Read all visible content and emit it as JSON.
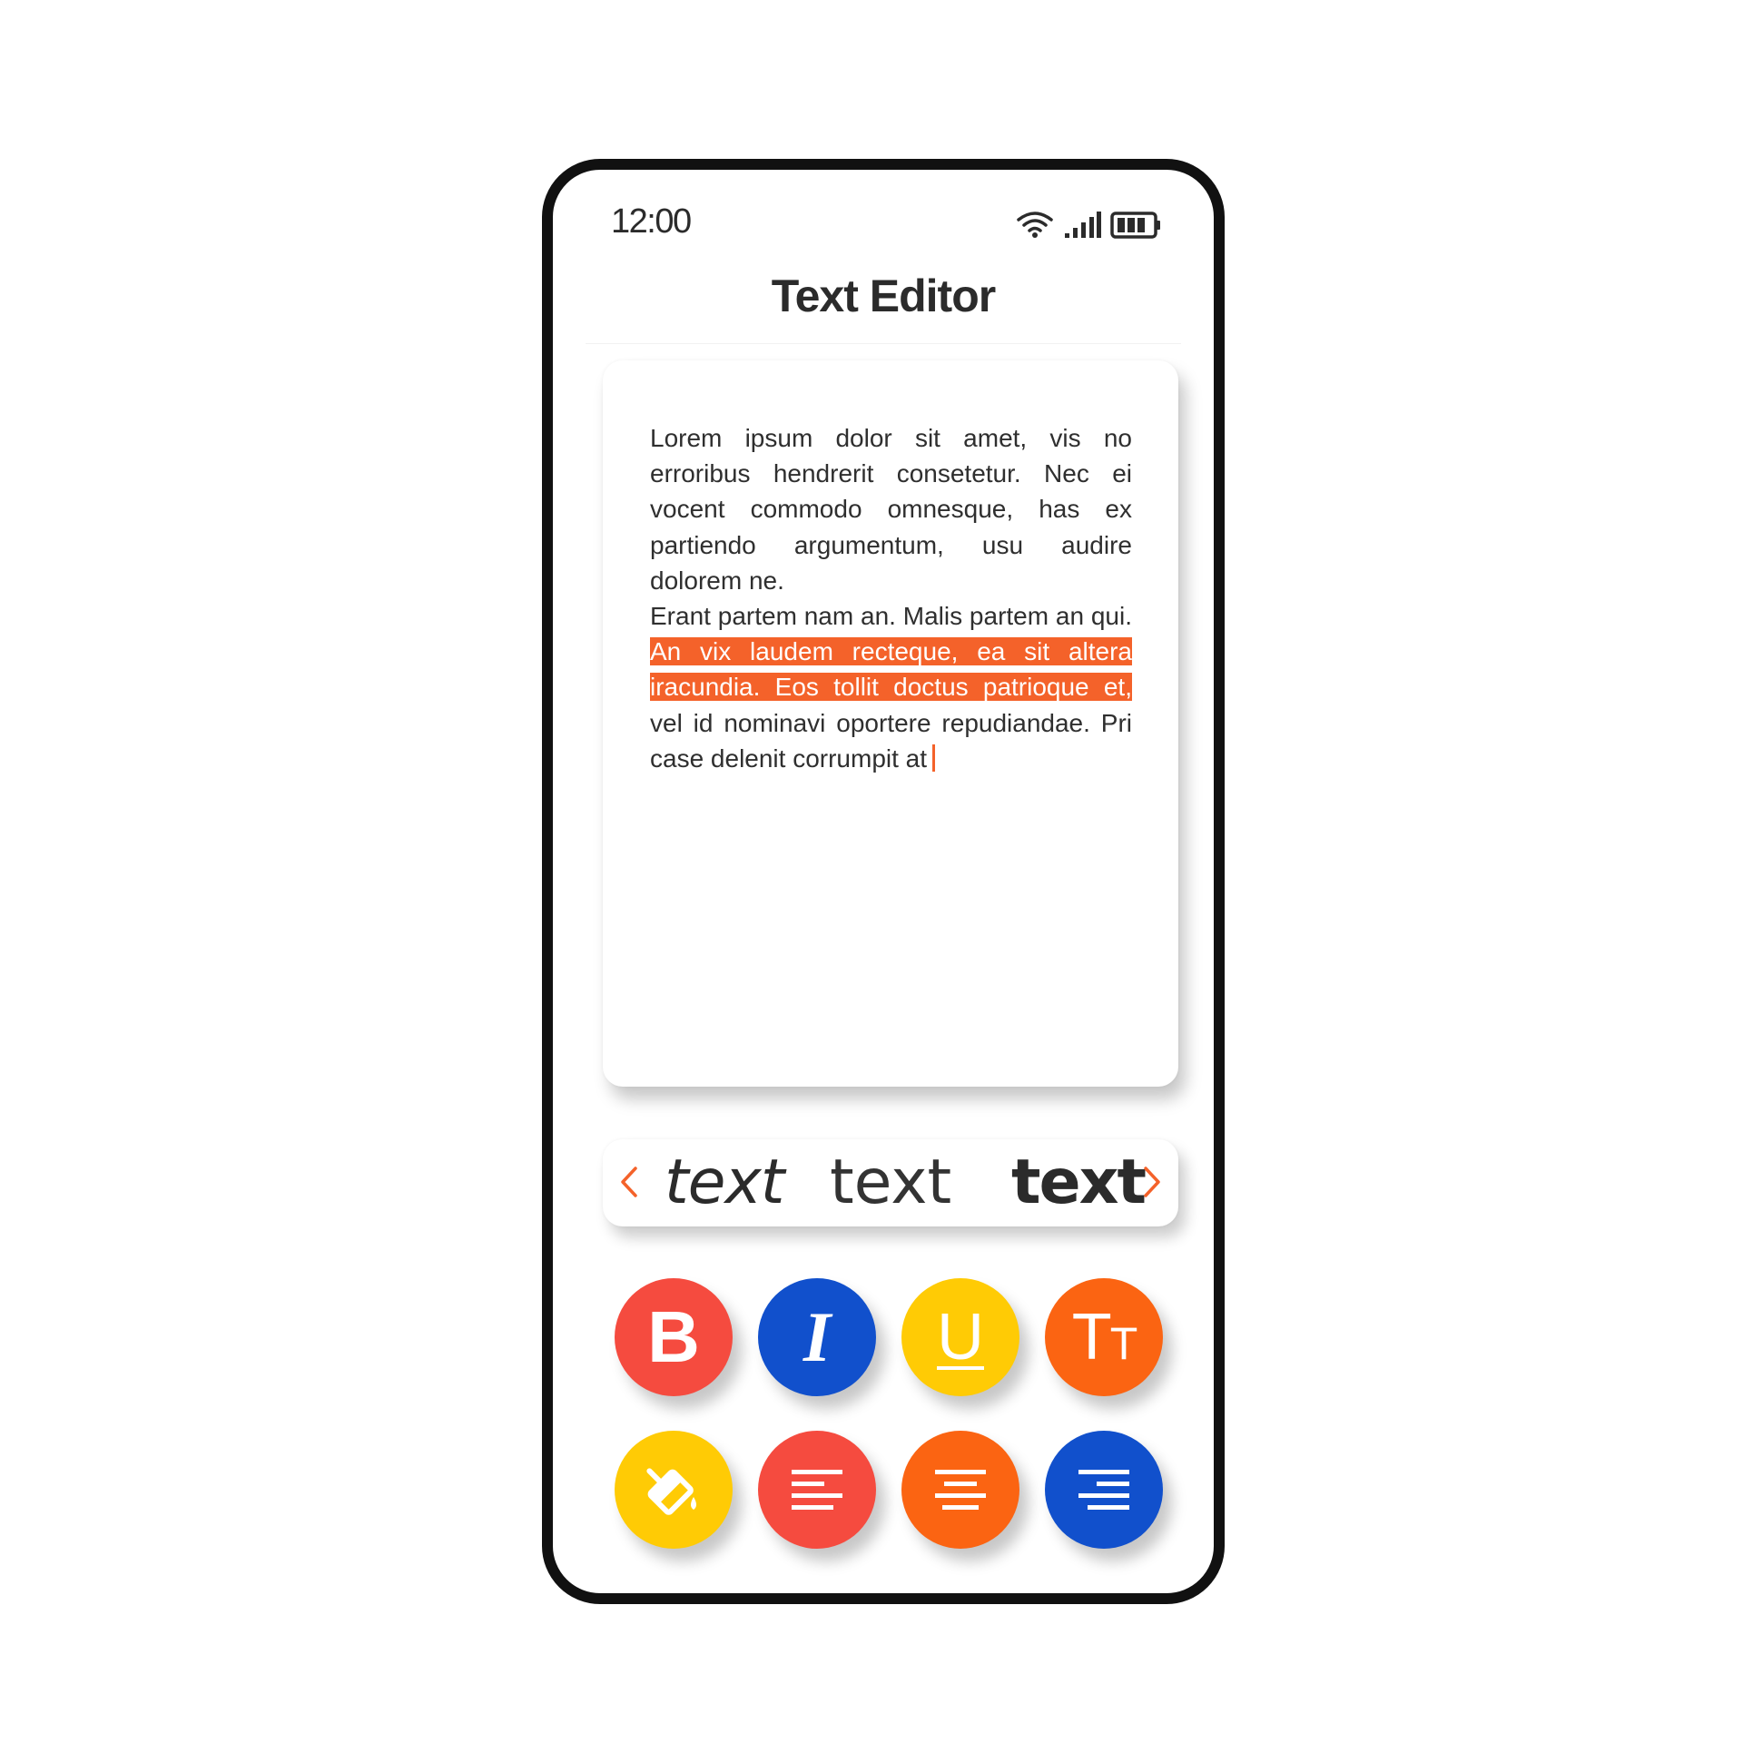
{
  "status_bar": {
    "time": "12:00",
    "icons": [
      "wifi-icon",
      "signal-icon",
      "battery-icon"
    ]
  },
  "header": {
    "title": "Text Editor"
  },
  "editor": {
    "paragraph_1": "Lorem ipsum dolor sit amet, vis no erroribus hendrerit consetetur. Nec ei vocent commodo omnesque, has ex partiendo argumentum, usu audire dolorem ne.",
    "paragraph_2_before": "Erant partem nam an. Malis partem an qui. ",
    "paragraph_2_selected": "An vix laudem recteque, ea sit altera iracundia. Eos tollit doctus patrioque et,",
    "paragraph_2_after": " vel id nominavi oportere repudiandae. Pri case delenit corrumpit at",
    "selection_color": "#f4622a"
  },
  "font_picker": {
    "options": [
      "text",
      "text",
      "text"
    ],
    "accent_color": "#f4622a"
  },
  "format_buttons": {
    "bold": {
      "label": "B",
      "color": "#f54b3f"
    },
    "italic": {
      "label": "I",
      "color": "#1150cc"
    },
    "underline": {
      "label": "U",
      "color": "#ffcb05"
    },
    "text_size": {
      "label_large": "T",
      "label_small": "T",
      "color": "#fb6412"
    },
    "fill_color": {
      "icon": "paint-bucket-icon",
      "color": "#ffcb05"
    },
    "align_left": {
      "icon": "align-left-icon",
      "color": "#f54b3f"
    },
    "align_center": {
      "icon": "align-center-icon",
      "color": "#fb6412"
    },
    "align_right": {
      "icon": "align-right-icon",
      "color": "#1150cc"
    }
  }
}
